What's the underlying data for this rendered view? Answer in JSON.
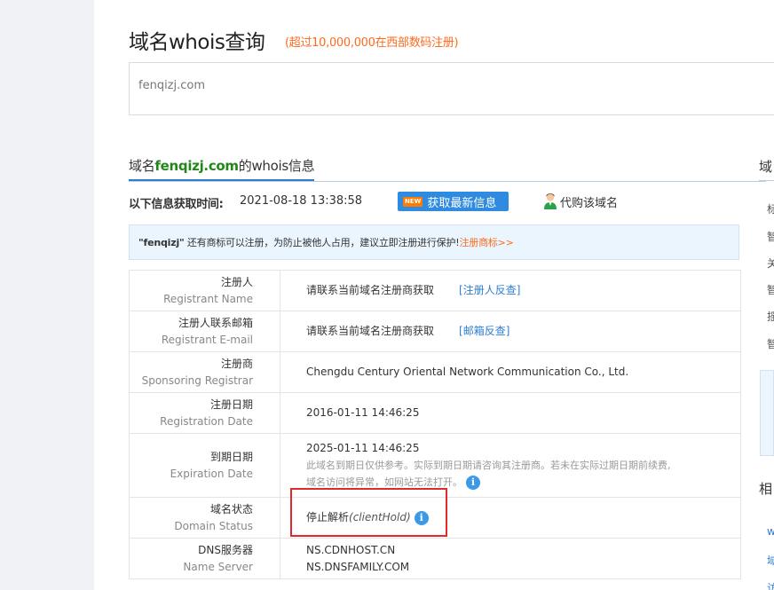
{
  "page": {
    "title": "域名whois查询",
    "subtitle": "(超过10,000,000在西部数码注册)"
  },
  "search": {
    "value": "fenqizj.com"
  },
  "section": {
    "prefix": "域名",
    "domain": "fenqizj.com",
    "suffix": "的whois信息"
  },
  "fetch": {
    "label": "以下信息获取时间:",
    "time": "2021-08-18 13:38:58",
    "refresh_badge": "NEW",
    "refresh_label": "获取最新信息",
    "proxy_label": "代购该域名"
  },
  "notice": {
    "name": "\"fenqizj\"",
    "text": " 还有商标可以注册，为防止被他人占用，建议立即注册进行保护!",
    "link": "注册商标>>"
  },
  "rows": [
    {
      "cn": "注册人",
      "en": "Registrant Name",
      "value": "请联系当前域名注册商获取",
      "link": "[注册人反查]"
    },
    {
      "cn": "注册人联系邮箱",
      "en": "Registrant E-mail",
      "value": "请联系当前域名注册商获取",
      "link": "[邮箱反查]"
    },
    {
      "cn": "注册商",
      "en": "Sponsoring Registrar",
      "value": "Chengdu Century Oriental Network Communication Co., Ltd."
    },
    {
      "cn": "注册日期",
      "en": "Registration Date",
      "value": "2016-01-11 14:46:25"
    },
    {
      "cn": "到期日期",
      "en": "Expiration Date",
      "value": "2025-01-11 14:46:25",
      "note1": "此域名到期日仅供参考。实际到期日期请咨询其注册商。若未在实际过期日期前续费,",
      "note2": "域名访问将异常，如网站无法打开。"
    },
    {
      "cn": "域名状态",
      "en": "Domain Status",
      "value": "停止解析",
      "value_en": "(clientHold)"
    },
    {
      "cn": "DNS服务器",
      "en": "Name Server",
      "ns1": "NS.CDNHOST.CN",
      "ns2": "NS.DNSFAMILY.COM"
    }
  ],
  "info_glyph": "i",
  "sidebar": {
    "head1": "域",
    "items": [
      "标",
      "智",
      "关",
      "智",
      "摇",
      "智"
    ],
    "head2": "相",
    "links": [
      "w",
      "域",
      "访"
    ]
  },
  "colors": {
    "accent": "#2f8be0",
    "orange": "#ff6a1f",
    "green": "#22861a",
    "highlight": "#e02b2b"
  }
}
